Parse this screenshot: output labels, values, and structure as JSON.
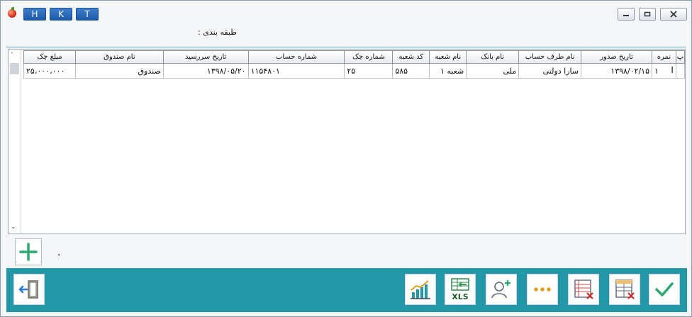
{
  "titlebar": {
    "hkt_buttons": [
      "H",
      "K",
      "T"
    ],
    "minimize_icon": "minimize-icon",
    "restore_icon": "restore-icon",
    "close_icon": "close-icon"
  },
  "header": {
    "classification_label": "طبقه بندی :"
  },
  "grid": {
    "columns": [
      "ردیف",
      "شماره",
      "تاریخ صدور",
      "نام طرف حساب",
      "نام بانک",
      "نام شعبه",
      "کد شعبه",
      "شماره چک",
      "شماره حساب",
      "تاریخ سررسید",
      "نام صندوق",
      "مبلغ چک"
    ],
    "column_headers_display": [
      "پ",
      "نمره",
      "تاریخ صدور",
      "نام طرف حساب",
      "نام بانک",
      "نام شعبه",
      "کد شعبه",
      "شماره چک",
      "شماره حساب",
      "تاریخ سررسید",
      "نام صندوق",
      "مبلغ چک"
    ],
    "rows": [
      {
        "row_marker": "",
        "number": "۱",
        "issue_date": "۱۳۹۸/۰۲/۱۵",
        "party_name": "سارا دولتی",
        "bank_name": "ملی",
        "branch_name": "شعبه ۱",
        "branch_code": "۵۸۵",
        "check_number": "۲۵",
        "account_number": "۱۱۵۴۸۰۱",
        "due_date": "۱۳۹۸/۰۵/۲۰",
        "fund_name": "صندوق",
        "amount": "۲۵،۰۰۰،۰۰۰"
      }
    ]
  },
  "footer_area": {
    "add_icon": "plus-icon",
    "status_text": "."
  },
  "toolbar": {
    "exit_icon": "exit-door-icon",
    "chart_icon": "bar-chart-icon",
    "xls_icon": "excel-export-icon",
    "xls_label": "XLS",
    "add_user_icon": "add-user-icon",
    "more_icon": "more-dots-icon",
    "delete_rows_icon": "delete-list-icon",
    "delete_table_icon": "delete-table-icon",
    "confirm_icon": "check-icon"
  },
  "colors": {
    "toolbar_bg": "#2297a8",
    "hkt_blue": "#2a6cc0",
    "confirm_green": "#2aa870"
  }
}
